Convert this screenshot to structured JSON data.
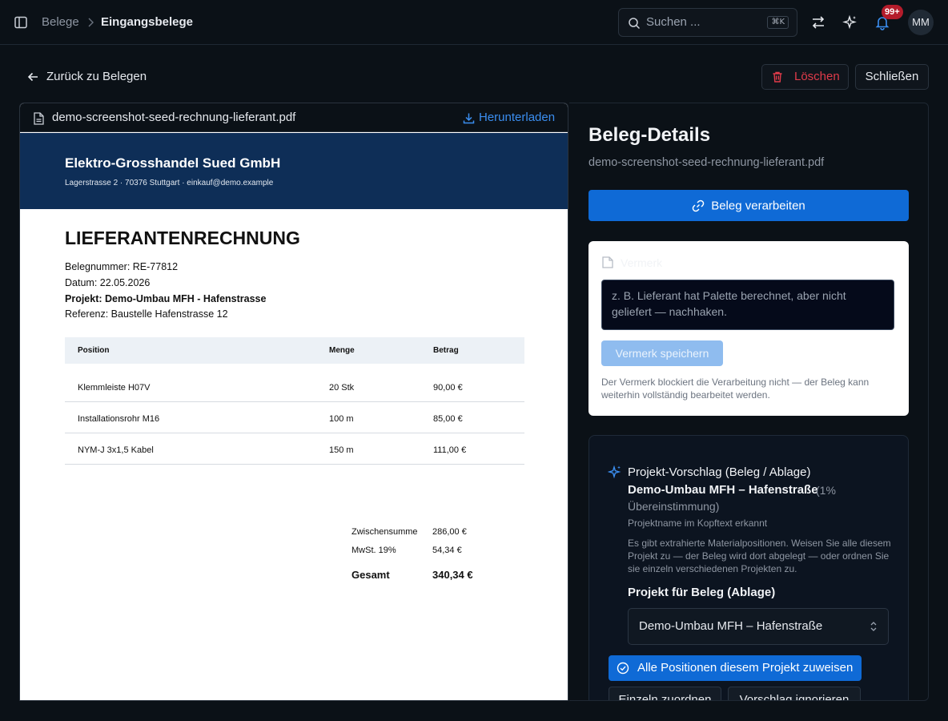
{
  "topbar": {
    "breadcrumb": [
      "Belege",
      "Eingangsbelege"
    ],
    "search_placeholder": "Suchen ...",
    "search_shortcut": "⌘K",
    "notification_count": "99+",
    "avatar_initials": "MM"
  },
  "header": {
    "back_label": "Zurück zu Belegen",
    "delete_label": "Löschen",
    "close_label": "Schließen"
  },
  "viewer": {
    "filename": "demo-screenshot-seed-rechnung-lieferant.pdf",
    "download_label": "Herunterladen"
  },
  "pdf": {
    "company": "Elektro-Grosshandel Sued GmbH",
    "address": "Lagerstrasse 2 · 70376 Stuttgart · einkauf@demo.example",
    "title": "LIEFERANTENRECHNUNG",
    "meta": [
      "Belegnummer: RE-77812",
      "Datum: 22.05.2026",
      "Projekt: Demo-Umbau MFH - Hafenstrasse",
      "Referenz: Baustelle Hafenstrasse 12"
    ],
    "columns": [
      "Position",
      "Menge",
      "Betrag"
    ],
    "rows": [
      [
        "Klemmleiste H07V",
        "20 Stk",
        "90,00 €"
      ],
      [
        "Installationsrohr M16",
        "100 m",
        "85,00 €"
      ],
      [
        "NYM-J 3x1,5 Kabel",
        "150 m",
        "111,00 €"
      ]
    ],
    "totals": [
      [
        "Zwischensumme",
        "286,00 €"
      ],
      [
        "MwSt. 19%",
        "54,34 €"
      ],
      [
        "Gesamt",
        "340,34 €"
      ]
    ]
  },
  "details": {
    "title": "Beleg-Details",
    "filename": "demo-screenshot-seed-rechnung-lieferant.pdf",
    "process_label": "Beleg verarbeiten",
    "note": {
      "label": "Vermerk",
      "placeholder": "z. B. Lieferant hat Palette berechnet, aber nicht geliefert — nachhaken.",
      "save_label": "Vermerk speichern",
      "hint": "Der Vermerk blockiert die Verarbeitung nicht — der Beleg kann weiterhin vollständig bearbeitet werden."
    },
    "suggestion": {
      "heading": "Projekt-Vorschlag (Beleg / Ablage)",
      "project": "Demo-Umbau MFH – Hafenstraße",
      "match": "(1%",
      "match2": "Übereinstimmung)",
      "reason": "Projektname im Kopftext erkannt",
      "description": "Es gibt extrahierte Materialpositionen. Weisen Sie alle diesem Projekt zu — der Beleg wird dort abgelegt — oder ordnen Sie sie einzeln verschiedenen Projekten zu.",
      "select_label": "Projekt für Beleg (Ablage)",
      "select_value": "Demo-Umbau MFH – Hafenstraße",
      "assign_all_label": "Alle Positionen diesem Projekt zuweisen",
      "individual_label": "Einzeln zuordnen",
      "ignore_label": "Vorschlag ignorieren"
    }
  },
  "colors": {
    "accent": "#0f6ad6",
    "danger": "#e03b4a",
    "pdf_banner": "#0e2e57"
  }
}
